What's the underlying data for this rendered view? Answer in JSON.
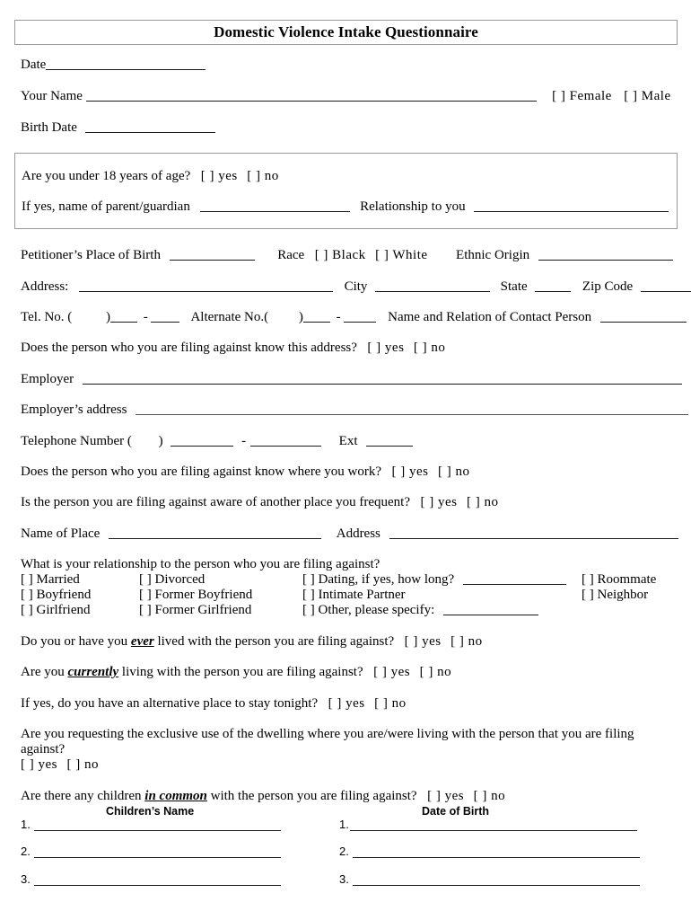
{
  "document": {
    "title": "Domestic Violence Intake Questionnaire"
  },
  "header": {
    "date_label": "Date",
    "your_name_label": "Your Name",
    "female_checkbox": "[   ] Female",
    "male_checkbox": "[   ] Male",
    "birth_date_label": "Birth Date"
  },
  "minor_section": {
    "under18_question": "Are you under 18 years of age?",
    "under18_yes": "[   ] yes",
    "under18_no": "[   ] no",
    "parent_guardian_label": "If yes, name of parent/guardian",
    "relationship_to_you_label": "Relationship to you"
  },
  "petitioner": {
    "place_of_birth_label": "Petitioner’s Place of Birth",
    "race_label": "Race",
    "race_black": "[  ] Black",
    "race_white": "[  ] White",
    "ethnic_origin_label": "Ethnic Origin",
    "address_label": "Address:",
    "city_label": "City",
    "state_label": "State",
    "zip_label": "Zip Code",
    "tel_label": "Tel. No. (",
    "tel_close": ")",
    "tel_dash": "-",
    "alternate_label": "Alternate No.(",
    "alternate_close": ")",
    "alternate_dash": "-",
    "contact_person_label": "Name and Relation of Contact Person",
    "knows_address_question": "Does the person who you are filing against know this address?",
    "knows_address_yes": "[  ] yes",
    "knows_address_no": "[  ] no"
  },
  "employment": {
    "employer_label": "Employer",
    "employer_address_label": "Employer’s address",
    "telephone_label": "Telephone Number (",
    "telephone_close": ")",
    "telephone_dash": "-",
    "ext_label": "Ext",
    "knows_work_question": "Does the person who you are filing against know where you work?",
    "knows_work_yes": "[  ] yes",
    "knows_work_no": "[  ] no",
    "frequent_question": "Is the person you are filing against aware of another place you frequent?",
    "frequent_yes": "[   ] yes",
    "frequent_no": "[   ] no",
    "name_of_place_label": "Name of Place",
    "place_address_label": "Address"
  },
  "relationship": {
    "question": "What is your relationship to the person who you are filing against?",
    "column1": [
      {
        "box": "[ ]",
        "label": "Married"
      },
      {
        "box": "[ ]",
        "label": "Boyfriend"
      },
      {
        "box": "[ ]",
        "label": "Girlfriend"
      }
    ],
    "column2": [
      {
        "box": "[  ]",
        "label": "Divorced"
      },
      {
        "box": "[  ]",
        "label": "Former Boyfriend"
      },
      {
        "box": "[  ]",
        "label": "Former Girlfriend"
      }
    ],
    "column3": [
      {
        "box": "[  ]",
        "label": "Dating, if yes, how long?"
      },
      {
        "box": "[  ]",
        "label": "Intimate Partner"
      },
      {
        "box": "[  ]",
        "label": "Other, please specify:"
      }
    ],
    "column4": [
      {
        "box": "[  ]",
        "label": "Roommate"
      },
      {
        "box": "[  ]",
        "label": "Neighbor"
      }
    ]
  },
  "cohabitation": {
    "ever_prefix": "Do you or have you ",
    "ever_emph": "ever",
    "ever_suffix": " lived with the person you are filing against?",
    "ever_yes": "[   ] yes",
    "ever_no": "[   ] no",
    "currently_prefix": "Are you ",
    "currently_emph": "currently",
    "currently_suffix": " living with the person you are filing against?",
    "currently_yes": "[   ] yes",
    "currently_no": "[   ] no",
    "alternative_question": "If yes, do you have an alternative place to stay tonight?",
    "alternative_yes": "[   ] yes",
    "alternative_no": "[   ] no"
  },
  "exclusive_use": {
    "line1": "Are you requesting the exclusive use of the dwelling where you are/were living with the person that you are filing",
    "line2": "against?",
    "yes": "[   ] yes",
    "no": "[   ] no"
  },
  "children": {
    "question_prefix": "Are there any children ",
    "question_emph": "in common",
    "question_suffix": " with the person you are filing against?",
    "yes": "[   ] yes",
    "no": "[   ] no",
    "name_header": "Children’s Name",
    "dob_header": "Date of Birth",
    "rows": [
      {
        "num": "1."
      },
      {
        "num": "2."
      },
      {
        "num": "3."
      }
    ],
    "dob_rows": [
      {
        "num": "1."
      },
      {
        "num": "2."
      },
      {
        "num": "3."
      }
    ]
  }
}
